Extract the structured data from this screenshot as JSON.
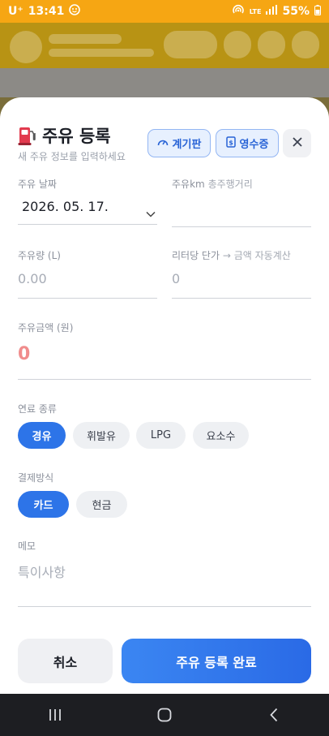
{
  "status": {
    "carrier": "U⁺",
    "time": "13:41",
    "network": "LTE",
    "battery": "55%"
  },
  "sheet": {
    "title": "주유 등록",
    "subtitle": "새 주유 정보를 입력하세요",
    "dashboard_button": "계기판",
    "receipt_button": "영수증"
  },
  "form": {
    "date_label": "주유 날짜",
    "date_value": "2026. 05. 17.",
    "odometer_label": "주유km",
    "odometer_hint": "총주행거리",
    "volume_label": "주유량 (L)",
    "volume_placeholder": "0.00",
    "unit_price_label": "리터당 단가",
    "unit_price_hint": "→ 금액 자동계산",
    "unit_price_placeholder": "0",
    "amount_label": "주유금액 (원)",
    "amount_value": "0",
    "fuel_type_label": "연료 종류",
    "fuel_types": [
      "경유",
      "휘발유",
      "LPG",
      "요소수"
    ],
    "fuel_type_selected": "경유",
    "payment_label": "결제방식",
    "payment_methods": [
      "카드",
      "현금"
    ],
    "payment_selected": "카드",
    "memo_label": "메모",
    "memo_placeholder": "특이사항"
  },
  "actions": {
    "cancel": "취소",
    "submit": "주유 등록 완료"
  },
  "colors": {
    "accent": "#2d74e8",
    "statusbar": "#f6a613",
    "amount_zero": "#f08c8c"
  }
}
